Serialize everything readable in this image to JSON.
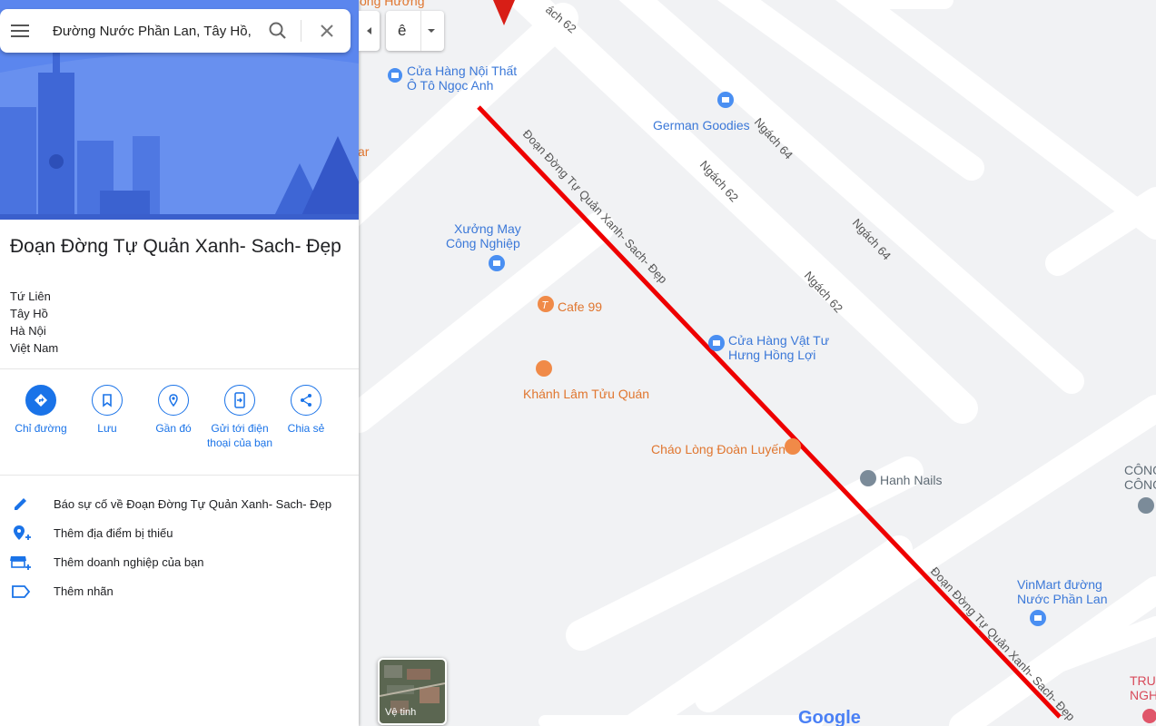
{
  "search": {
    "value": "Đường Nước Phần Lan, Tây Hồ, Hà Nội"
  },
  "place": {
    "title": "Đoạn Đờng Tự Quản Xanh- Sach- Đẹp",
    "address": [
      "Tứ Liên",
      "Tây Hồ",
      "Hà Nội",
      "Việt Nam"
    ]
  },
  "actions": [
    {
      "label": "Chỉ đường",
      "icon": "directions-icon"
    },
    {
      "label": "Lưu",
      "icon": "bookmark-icon"
    },
    {
      "label": "Gần đó",
      "icon": "nearby-icon"
    },
    {
      "label": "Gửi tới điện thoại của bạn",
      "icon": "send-to-phone-icon"
    },
    {
      "label": "Chia sẻ",
      "icon": "share-icon"
    }
  ],
  "links": [
    {
      "label": "Báo sự cố về Đoạn Đờng Tự Quản Xanh- Sach- Đẹp",
      "icon": "pencil-icon"
    },
    {
      "label": "Thêm địa điểm bị thiếu",
      "icon": "add-place-icon"
    },
    {
      "label": "Thêm doanh nghiệp của bạn",
      "icon": "add-business-icon"
    },
    {
      "label": "Thêm nhãn",
      "icon": "label-icon"
    }
  ],
  "map": {
    "language_value": "ê",
    "satellite_label": "Vệ tinh",
    "logo": "Google",
    "route_color": "#ee0000",
    "road_labels": {
      "ngach62_a": "Ngách 62",
      "ngach64_a": "Ngách 64",
      "ngach62_b": "Ngách 62",
      "ngach64_b": "Ngách 64",
      "ngach62_c": "Ngách 62",
      "ngach62_top": "ách 62",
      "route_a": "Đoạn Đờng Tự Quản Xanh- Sach- Đẹp",
      "route_b": "Đoạn Đờng Tự Quản Xanh- Sach- Đẹp"
    },
    "pois": {
      "cua_hang_noi_that": [
        "Cửa Hàng Nội Thất",
        "Ô Tô Ngọc Anh"
      ],
      "german_goodies": "German Goodies",
      "xuong_may": [
        "Xưởng May",
        "Công Nghiệp"
      ],
      "cafe99": "Cafe 99",
      "vat_tu": [
        "Cửa Hàng Vật Tư",
        "Hưng Hồng Lợi"
      ],
      "khanh_lam": "Khánh Lâm Tửu Quán",
      "chao_long": "Cháo Lòng Đoàn Luyến",
      "hanh_nails": "Hanh Nails",
      "vinmart": [
        "VinMart đường",
        "Nước Phần Lan"
      ],
      "cong_partial": [
        "CÔNG",
        "CÔNG"
      ],
      "truong_partial": [
        "TRU",
        "NGH"
      ],
      "top_partial": "ong Hương",
      "ar_partial": "ar"
    }
  }
}
